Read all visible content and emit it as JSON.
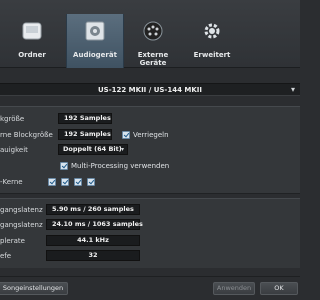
{
  "tabs": [
    {
      "label": "Ordner",
      "icon": "folder-icon"
    },
    {
      "label": "Audiogerät",
      "icon": "audio-device-icon"
    },
    {
      "label": "Externe Geräte",
      "icon": "external-devices-icon"
    },
    {
      "label": "Erweitert",
      "icon": "advanced-gear-icon"
    }
  ],
  "device": {
    "name": "US-122 MKII / US-144 MKII"
  },
  "settings": {
    "buffer_label": "kgröße",
    "buffer_value": "192 Samples",
    "device_buffer_label": "rne Blockgröße",
    "device_buffer_value": "192 Samples",
    "lock_label": "Verriegeln",
    "precision_label": "auigkeit",
    "precision_value": "Doppelt (64 Bit)",
    "multiprocessing_label": "Multi-Processing verwenden",
    "cores_label": "-Kerne"
  },
  "latency": {
    "input_label": "gangslatenz",
    "input_value": "5.90 ms / 260 samples",
    "output_label": "gangslatenz",
    "output_value": "24.10 ms / 1063 samples",
    "samplerate_label": "plerate",
    "samplerate_value": "44.1 kHz",
    "bitdepth_label": "efe",
    "bitdepth_value": "32"
  },
  "footer": {
    "song_settings": "Songeinstellungen",
    "apply": "Anwenden",
    "ok": "OK"
  }
}
